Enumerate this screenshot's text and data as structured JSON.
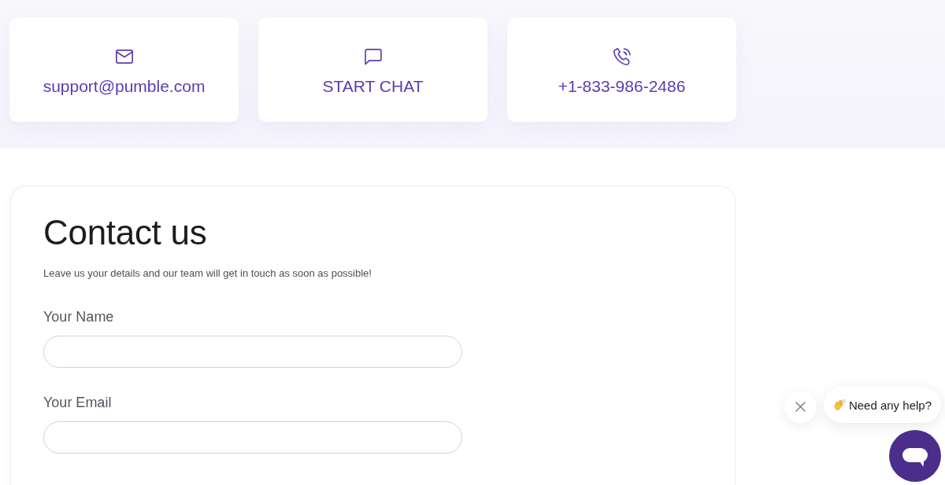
{
  "contact_cards": [
    {
      "kind": "email",
      "label": "support@pumble.com"
    },
    {
      "kind": "chat",
      "label": "START CHAT"
    },
    {
      "kind": "phone",
      "label": "+1-833-986-2486"
    }
  ],
  "contact_form": {
    "title": "Contact us",
    "subtitle": "Leave us your details and our team will get in touch as soon as possible!",
    "fields": [
      {
        "label": "Your Name"
      },
      {
        "label": "Your Email"
      }
    ]
  },
  "chat_widget": {
    "prompt": "Need any help?"
  }
}
